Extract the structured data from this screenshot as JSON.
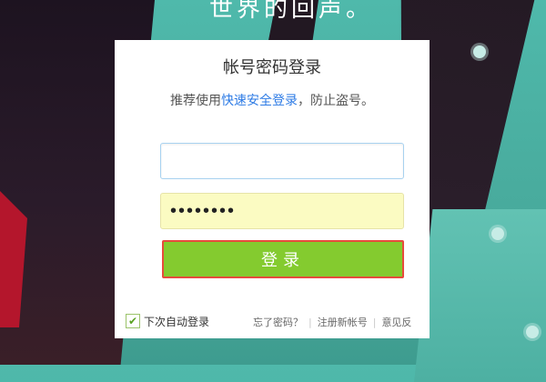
{
  "banner": {
    "title": "世界的回声。"
  },
  "login": {
    "title": "帐号密码登录",
    "subtitle_prefix": "推荐使用",
    "subtitle_link": "快速安全登录",
    "subtitle_suffix": "，防止盗号。",
    "username_value": "",
    "password_value": "••••••••",
    "submit_label": "登录",
    "remember_label": "下次自动登录",
    "remember_checked": true,
    "links": {
      "forgot": "忘了密码？",
      "register": "注册新帐号",
      "feedback": "意见反"
    }
  },
  "colors": {
    "accent_link": "#2d7be5",
    "button_green": "#84cb2f",
    "button_highlight_border": "#e64b3c",
    "password_bg": "#fbfbc2",
    "background_teal": "#4fb9ab"
  },
  "icons": {
    "remember_check": "check-icon"
  }
}
